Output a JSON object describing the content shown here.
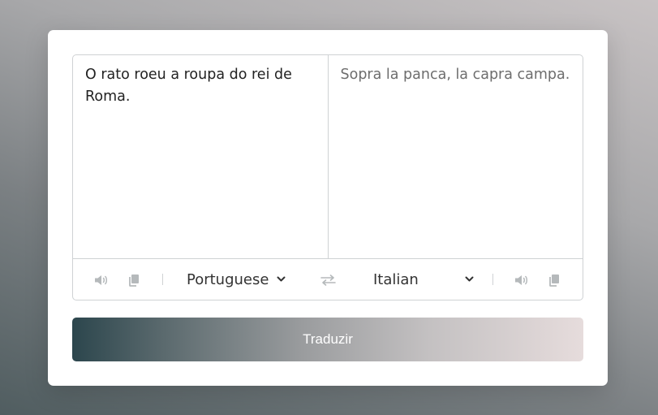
{
  "from_text": "O rato roeu a roupa do rei de Roma.",
  "to_text": "Sopra la panca, la capra campa.",
  "from_language": "Portuguese",
  "to_language": "Italian",
  "translate_button_label": "Traduzir",
  "icons": {
    "from_speak": "volume-icon",
    "from_copy": "copy-icon",
    "exchange": "exchange-icon",
    "to_speak": "volume-icon",
    "to_copy": "copy-icon",
    "chevron": "chevron-down-icon"
  },
  "colors": {
    "icon": "#b5b9bb",
    "button_gradient_start": "#2c464d",
    "button_gradient_end": "#e6dcdc",
    "border": "#cfd2d4"
  }
}
